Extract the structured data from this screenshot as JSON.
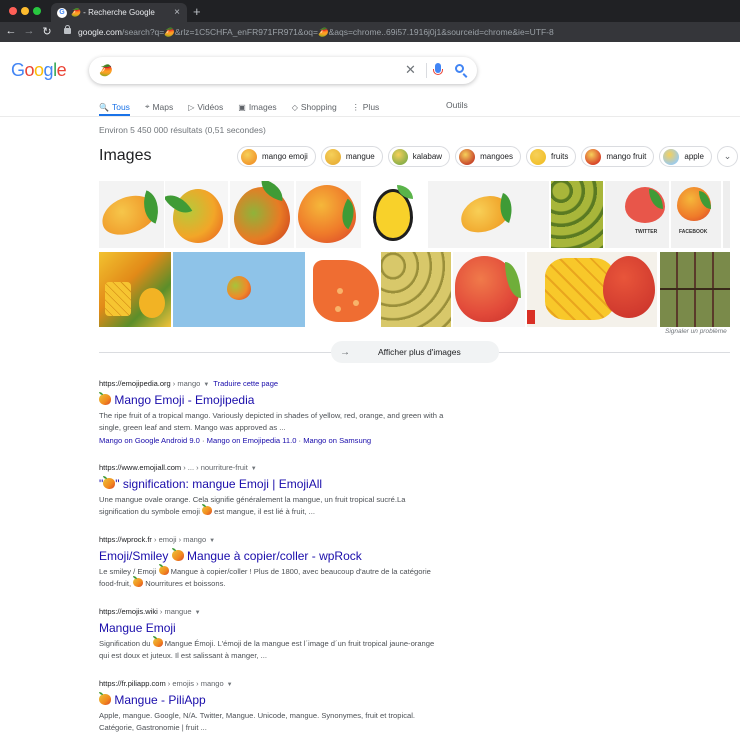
{
  "browser": {
    "tab_title": "🥭 - Recherche Google",
    "favicon_letter": "G",
    "close_glyph": "×",
    "new_tab_glyph": "+",
    "url_host": "google.com",
    "url_rest": "/search?q=🥭&rlz=1C5CHFA_enFR971FR971&oq=🥭&aqs=chrome..69i57.1916j0j1&sourceid=chrome&ie=UTF-8"
  },
  "search": {
    "logo_letters": [
      "G",
      "o",
      "o",
      "g",
      "l",
      "e"
    ],
    "logo_colors": [
      "#4285f4",
      "#ea4335",
      "#fbbc05",
      "#4285f4",
      "#34a853",
      "#ea4335"
    ],
    "query": "🥭",
    "clear_glyph": "✕"
  },
  "nav_tabs": [
    {
      "label": "Tous",
      "icon": "search-icon",
      "glyph": "🔍",
      "active": true
    },
    {
      "label": "Maps",
      "icon": "pin-icon",
      "glyph": "⌖"
    },
    {
      "label": "Vidéos",
      "icon": "play-icon",
      "glyph": "▷"
    },
    {
      "label": "Images",
      "icon": "image-icon",
      "glyph": "▣"
    },
    {
      "label": "Shopping",
      "icon": "tag-icon",
      "glyph": "◇"
    },
    {
      "label": "Plus",
      "icon": "more-vert-icon",
      "glyph": "⋮"
    }
  ],
  "tools_label": "Outils",
  "result_stats": "Environ 5 450 000 résultats (0,51 secondes)",
  "images": {
    "heading": "Images",
    "chips": [
      {
        "label": "mango emoji",
        "color": "#f29a2e"
      },
      {
        "label": "mangue",
        "color": "#e9b23a"
      },
      {
        "label": "kalabaw",
        "color": "#8db04a"
      },
      {
        "label": "mangoes",
        "color": "#c94a2c"
      },
      {
        "label": "fruits",
        "color": "#f2c12e"
      },
      {
        "label": "mango fruit",
        "color": "#d9472a"
      },
      {
        "label": "apple",
        "color": "#9fcbe8"
      }
    ],
    "chips_more_glyph": "⌄",
    "tile_labels": [
      "TWITTER",
      "FACEBOOK"
    ],
    "report_label": "Signaler un problème",
    "more_label": "Afficher plus d'images",
    "more_arrow": "→"
  },
  "results": [
    {
      "url": "https://emojipedia.org",
      "breadcrumb": " › mango",
      "translate": "Traduire cette page",
      "title": "Mango Emoji - Emojipedia",
      "snippet": "The ripe fruit of a tropical mango. Variously depicted in shades of yellow, red, orange, and green with a single, green leaf and stem. Mango was approved as ...",
      "sitelinks": [
        "Mango on Google Android 9.0",
        "Mango on Emojipedia 11.0",
        "Mango on Samsung"
      ]
    },
    {
      "url": "https://www.emojiall.com",
      "breadcrumb": " › ... › nourriture-fruit",
      "title": "\"🥭\" signification: mangue Emoji | EmojiAll",
      "title_prefix": "\"",
      "title_rest": "\" signification: mangue Emoji | EmojiAll",
      "snippet_a": "Une mangue ovale orange. Cela signifie généralement la mangue, un fruit tropical sucré.La signification du symbole emoji ",
      "snippet_b": " est mangue, il est lié à fruit, ..."
    },
    {
      "url": "https://wprock.fr",
      "breadcrumb": " › emoji › mango",
      "title_a": "Emoji/Smiley ",
      "title_b": " Mangue à copier/coller - wpRock",
      "snippet_a": "Le smiley / Emoji ",
      "snippet_b": " Mangue à copier/coller ! Plus de 1800, avec beaucoup d'autre de la catégorie food-fruit, ",
      "snippet_c": " Nourritures et boissons."
    },
    {
      "url": "https://emojis.wiki",
      "breadcrumb": " › mangue",
      "title": "Mangue Emoji",
      "snippet_a": "Signification du ",
      "snippet_b": " Mangue Émoji. L'émoji de la mangue est l´image d´un fruit tropical jaune-orange qui est doux et juteux. Il est salissant à manger, ..."
    },
    {
      "url": "https://fr.piliapp.com",
      "breadcrumb": " › emojis › mango",
      "title_b": " Mangue - PiliApp",
      "snippet": "Apple, mangue. Google, N/A. Twitter, Mangue. Unicode, mangue. Synonymes, fruit et tropical. Catégorie, Gastronomie | fruit ..."
    }
  ]
}
